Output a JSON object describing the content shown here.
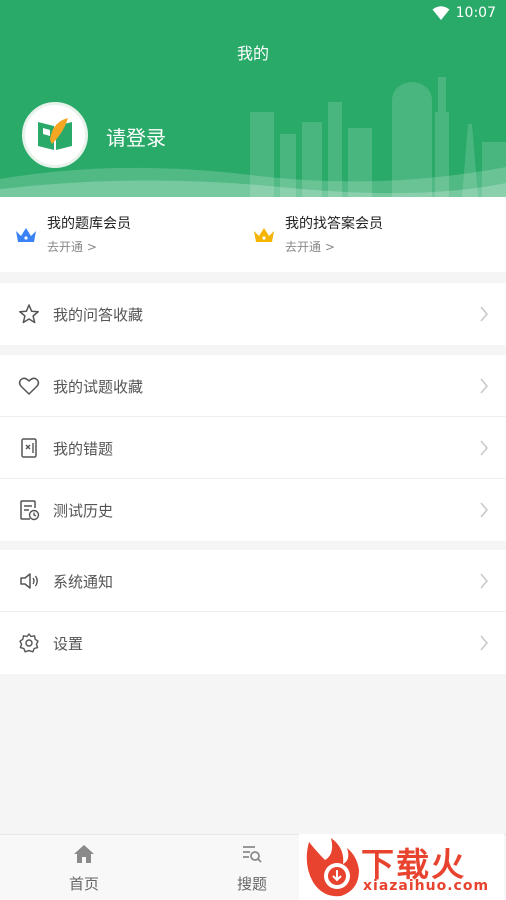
{
  "status_bar": {
    "time": "10:07"
  },
  "header": {
    "title": "我的",
    "login_label": "请登录"
  },
  "membership": [
    {
      "title": "我的题库会员",
      "subtitle": "去开通 >",
      "crown_color": "#3b82f6"
    },
    {
      "title": "我的找答案会员",
      "subtitle": "去开通 >",
      "crown_color": "#f5b400"
    }
  ],
  "menu": {
    "group1": [
      {
        "label": "我的问答收藏",
        "icon": "star-icon"
      }
    ],
    "group2": [
      {
        "label": "我的试题收藏",
        "icon": "heart-icon"
      },
      {
        "label": "我的错题",
        "icon": "wrong-question-icon"
      },
      {
        "label": "测试历史",
        "icon": "history-icon"
      }
    ],
    "group3": [
      {
        "label": "系统通知",
        "icon": "speaker-icon"
      },
      {
        "label": "设置",
        "icon": "gear-icon"
      }
    ]
  },
  "bottom_nav": [
    {
      "label": "首页",
      "icon": "home-icon"
    },
    {
      "label": "搜题",
      "icon": "search-list-icon"
    }
  ],
  "watermark": {
    "brand": "下载火",
    "url": "xiazaihuo.com"
  },
  "colors": {
    "primary": "#2aaa69",
    "watermark": "#e8432e"
  }
}
